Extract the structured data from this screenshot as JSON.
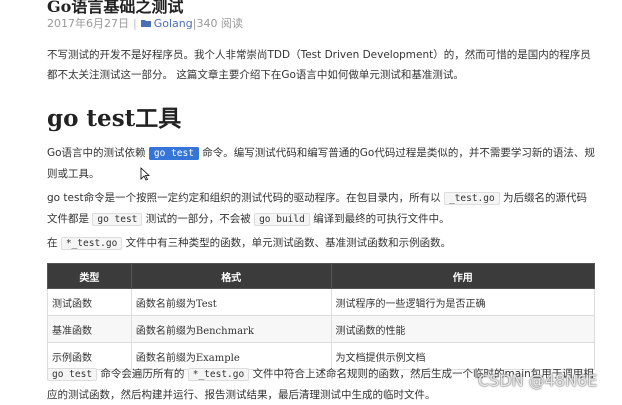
{
  "article": {
    "title": "Go语言基础之测试",
    "meta": {
      "date": "2017年6月27日",
      "separator": "|",
      "category": "Golang",
      "views": "|340 阅读"
    },
    "intro": "不写测试的开发不是好程序员。我个人非常崇尚TDD（Test Driven Development）的，然而可惜的是国内的程序员都不太关注测试这一部分。 这篇文章主要介绍下在Go语言中如何做单元测试和基准测试。",
    "section_heading": "go test工具",
    "p1": {
      "before": "Go语言中的测试依赖",
      "code": "go test",
      "after": "命令。编写测试代码和编写普通的Go代码过程是类似的，并不需要学习新的语法、规则或工具。"
    },
    "p2": {
      "t1": "go test命令是一个按照一定约定和组织的测试代码的驱动程序。在包目录内，所有以",
      "c1": "_test.go",
      "t2": "为后缀名的源代码文件都是",
      "c2": "go test",
      "t3": "测试的一部分，不会被",
      "c3": "go build",
      "t4": "编译到最终的可执行文件中。"
    },
    "p3": {
      "t1": "在",
      "c1": "*_test.go",
      "t2": "文件中有三种类型的函数，单元测试函数、基准测试函数和示例函数。"
    },
    "table": {
      "headers": [
        "类型",
        "格式",
        "作用"
      ],
      "rows": [
        [
          "测试函数",
          "函数名前缀为Test",
          "测试程序的一些逻辑行为是否正确"
        ],
        [
          "基准函数",
          "函数名前缀为Benchmark",
          "测试函数的性能"
        ],
        [
          "示例函数",
          "函数名前缀为Example",
          "为文档提供示例文档"
        ]
      ]
    },
    "p4": {
      "c1": "go test",
      "t1": "命令会遍历所有的",
      "c2": "*_test.go",
      "t2": "文件中符合上述命名规则的函数，然后生成一个临时的main包用于调用相应的测试函数，然后构建并运行、报告测试结果，最后清理测试中生成的临时文件。"
    }
  },
  "watermark": "CSDN @48N6E",
  "colors": {
    "selection": "#3574d9",
    "table_header": "#3b3b3b",
    "link": "#4a6fb5"
  }
}
